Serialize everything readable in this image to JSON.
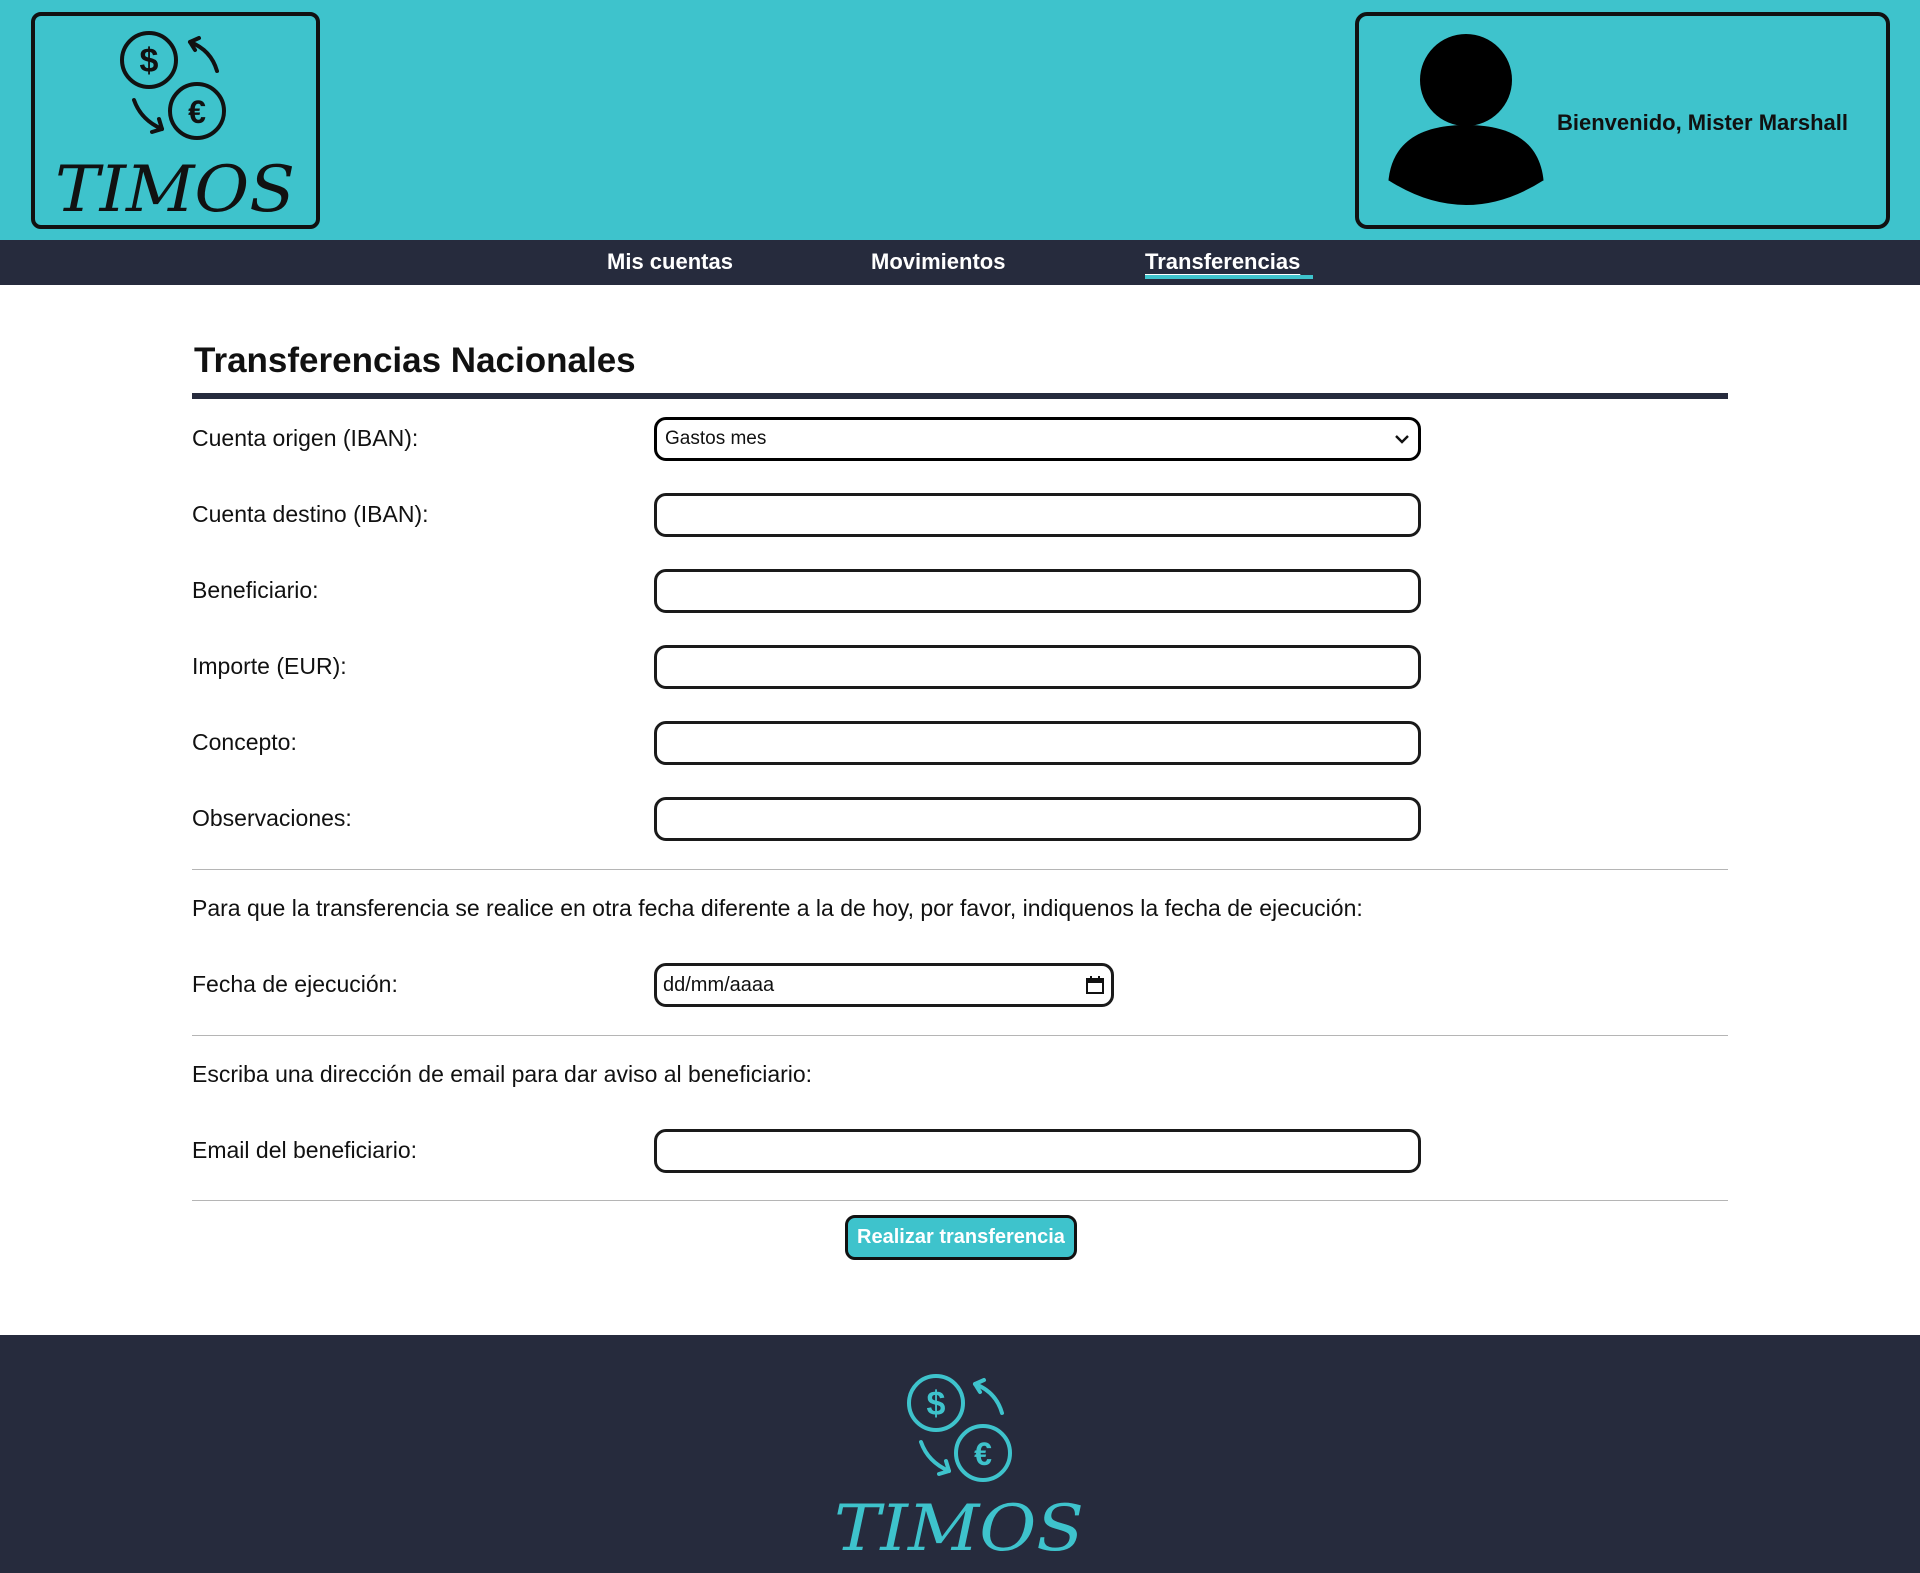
{
  "brand": {
    "name": "TIMOS",
    "logo_icon": "currency-exchange-icon",
    "accent": "#3ec3cc",
    "dark": "#262b3d"
  },
  "header": {
    "welcome": "Bienvenido, Mister Marshall",
    "avatar_icon": "user-avatar-icon"
  },
  "nav": {
    "items": [
      {
        "label": "Mis cuentas",
        "active": false
      },
      {
        "label": "Movimientos",
        "active": false
      },
      {
        "label": "Transferencias",
        "active": true
      }
    ]
  },
  "form": {
    "title": "Transferencias Nacionales",
    "fields": {
      "origin": {
        "label": "Cuenta origen (IBAN):",
        "value": "Gastos mes"
      },
      "destination": {
        "label": "Cuenta destino (IBAN):",
        "value": ""
      },
      "beneficiary": {
        "label": "Beneficiario:",
        "value": ""
      },
      "amount": {
        "label": "Importe (EUR):",
        "value": ""
      },
      "concept": {
        "label": "Concepto:",
        "value": ""
      },
      "notes": {
        "label": "Observaciones:",
        "value": ""
      }
    },
    "date_info": "Para que la transferencia se realice en otra fecha diferente a la de hoy, por favor, indiquenos la fecha de ejecución:",
    "date": {
      "label": "Fecha de ejecución:",
      "placeholder": "dd/mm/aaaa"
    },
    "email_info": "Escriba una dirección de email para dar aviso al beneficiario:",
    "email": {
      "label": "Email del beneficiario:",
      "value": ""
    },
    "submit_label": "Realizar transferencia"
  }
}
